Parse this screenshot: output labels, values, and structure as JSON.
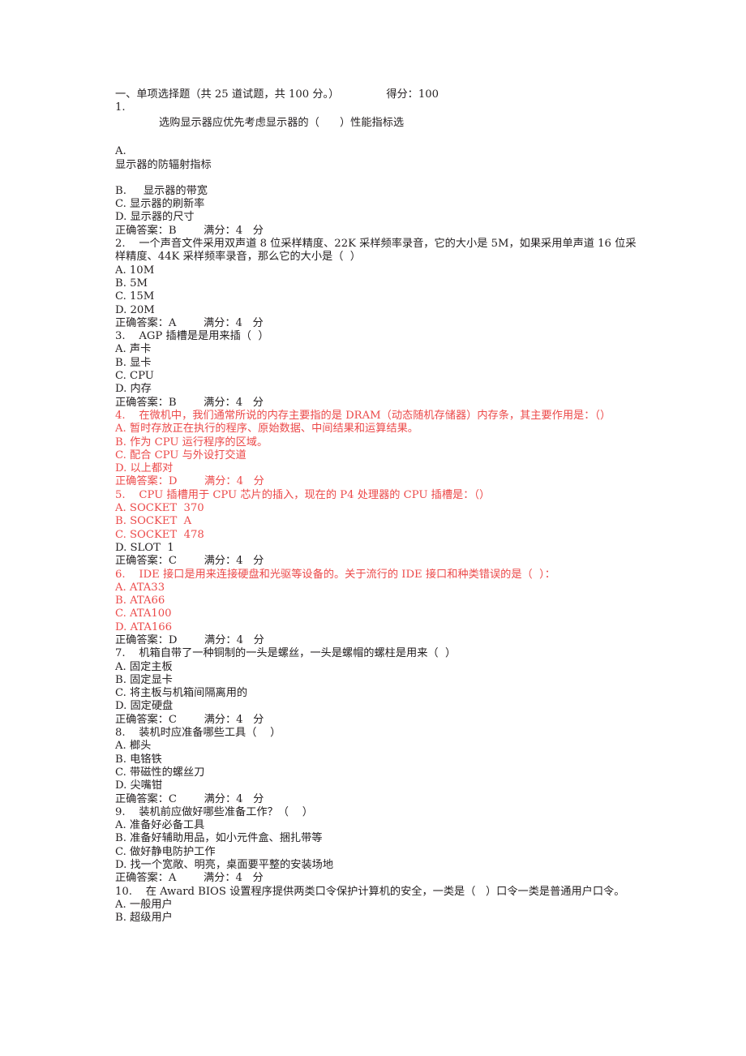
{
  "header": {
    "section_title": "一、单项选择题（共 25 道试题，共 100 分。）",
    "score_label": "得分：100"
  },
  "answer_line_template": "正确答案：{ans}        满分：{score}   分",
  "questions": [
    {
      "number": "1.",
      "stem": "选购显示器应优先考虑显示器的（      ）性能指标选",
      "stem_indented": true,
      "color": "black",
      "options": [
        {
          "label": "A.",
          "text": "显示器的防辐射指标",
          "own_line": true
        },
        {
          "label": "B.",
          "text": "     显示器的带宽"
        },
        {
          "label": "C.",
          "text": " 显示器的刷新率"
        },
        {
          "label": "D.",
          "text": " 显示器的尺寸"
        }
      ],
      "answer": "正确答案：B        满分：4   分"
    },
    {
      "number": "2.",
      "stem": "2.    一个声音文件采用双声道 8 位采样精度、22K 采样频率录音，它的大小是 5M，如果采用单声道 16 位采样精度、44K 采样频率录音，那么它的大小是（  ）",
      "color": "black",
      "options": [
        {
          "label": "A.",
          "text": " 10M"
        },
        {
          "label": "B.",
          "text": " 5M"
        },
        {
          "label": "C.",
          "text": " 15M"
        },
        {
          "label": "D.",
          "text": " 20M"
        }
      ],
      "answer": "正确答案：A        满分：4   分"
    },
    {
      "number": "3.",
      "stem": "3.    AGP 插槽是是用来插（  ）",
      "color": "black",
      "options": [
        {
          "label": "A.",
          "text": " 声卡"
        },
        {
          "label": "B.",
          "text": " 显卡"
        },
        {
          "label": "C.",
          "text": " CPU"
        },
        {
          "label": "D.",
          "text": " 内存"
        }
      ],
      "answer": "正确答案：B        满分：4   分"
    },
    {
      "number": "4.",
      "stem": "4.    在微机中，我们通常所说的内存主要指的是 DRAM（动态随机存储器）内存条，其主要作用是：（）",
      "color": "red",
      "options": [
        {
          "label": "A.",
          "text": " 暂时存放正在执行的程序、原始数据、中间结果和运算结果。",
          "color": "red"
        },
        {
          "label": "B.",
          "text": " 作为 CPU 运行程序的区域。",
          "color": "red"
        },
        {
          "label": "C.",
          "text": " 配合 CPU 与外设打交道",
          "color": "red"
        },
        {
          "label": "D.",
          "text": " 以上都对",
          "color": "red"
        }
      ],
      "answer": "正确答案：D        满分：4   分",
      "answer_color": "red"
    },
    {
      "number": "5.",
      "stem": "5.    CPU 插槽用于 CPU 芯片的插入，现在的 P4 处理器的 CPU 插槽是：（）",
      "color": "red",
      "options": [
        {
          "label": "A.",
          "text": " SOCKET  370",
          "color": "red"
        },
        {
          "label": "B.",
          "text": " SOCKET  A",
          "color": "red"
        },
        {
          "label": "C.",
          "text": " SOCKET  478",
          "color": "red"
        },
        {
          "label": "D.",
          "text": " SLOT  1",
          "color": "black"
        }
      ],
      "answer": "正确答案：C        满分：4   分",
      "answer_color": "black"
    },
    {
      "number": "6.",
      "stem": "6.    IDE 接口是用来连接硬盘和光驱等设备的。关于流行的 IDE 接口和种类错误的是（  ）：",
      "color": "red",
      "options": [
        {
          "label": "A.",
          "text": " ATA33",
          "color": "red"
        },
        {
          "label": "B.",
          "text": " ATA66",
          "color": "red"
        },
        {
          "label": "C.",
          "text": " ATA100",
          "color": "red"
        },
        {
          "label": "D.",
          "text": " ATA166",
          "color": "red"
        }
      ],
      "answer": "正确答案：D        满分：4   分",
      "answer_color": "black"
    },
    {
      "number": "7.",
      "stem": "7.    机箱自带了一种铜制的一头是螺丝，一头是螺帽的螺柱是用来（  ）",
      "color": "black",
      "options": [
        {
          "label": "A.",
          "text": " 固定主板"
        },
        {
          "label": "B.",
          "text": " 固定显卡"
        },
        {
          "label": "C.",
          "text": " 将主板与机箱间隔离用的"
        },
        {
          "label": "D.",
          "text": " 固定硬盘"
        }
      ],
      "answer": "正确答案：C        满分：4   分"
    },
    {
      "number": "8.",
      "stem": "8.    装机时应准备哪些工具（    ）",
      "color": "black",
      "options": [
        {
          "label": "A.",
          "text": " 榔头"
        },
        {
          "label": "B.",
          "text": " 电铬铁"
        },
        {
          "label": "C.",
          "text": " 带磁性的螺丝刀"
        },
        {
          "label": "D.",
          "text": " 尖嘴钳"
        }
      ],
      "answer": "正确答案：C        满分：4   分"
    },
    {
      "number": "9.",
      "stem": "9.    装机前应做好哪些准备工作？（    ）",
      "color": "black",
      "options": [
        {
          "label": "A.",
          "text": " 准备好必备工具"
        },
        {
          "label": "B.",
          "text": " 准备好辅助用品，如小元件盒、捆扎带等"
        },
        {
          "label": "C.",
          "text": " 做好静电防护工作"
        },
        {
          "label": "D.",
          "text": " 找一个宽敞、明亮，桌面要平整的安装场地"
        }
      ],
      "answer": "正确答案：A        满分：4   分"
    },
    {
      "number": "10.",
      "stem": "10.    在 Award BIOS 设置程序提供两类口令保护计算机的安全，一类是（   ）口令一类是普通用户口令。",
      "color": "black",
      "options": [
        {
          "label": "A.",
          "text": " 一般用户"
        },
        {
          "label": "B.",
          "text": " 超级用户"
        }
      ],
      "answer": null
    }
  ],
  "colors": {
    "text": "#231f20",
    "highlight_red": "#ec4a4a",
    "background": "#ffffff"
  }
}
